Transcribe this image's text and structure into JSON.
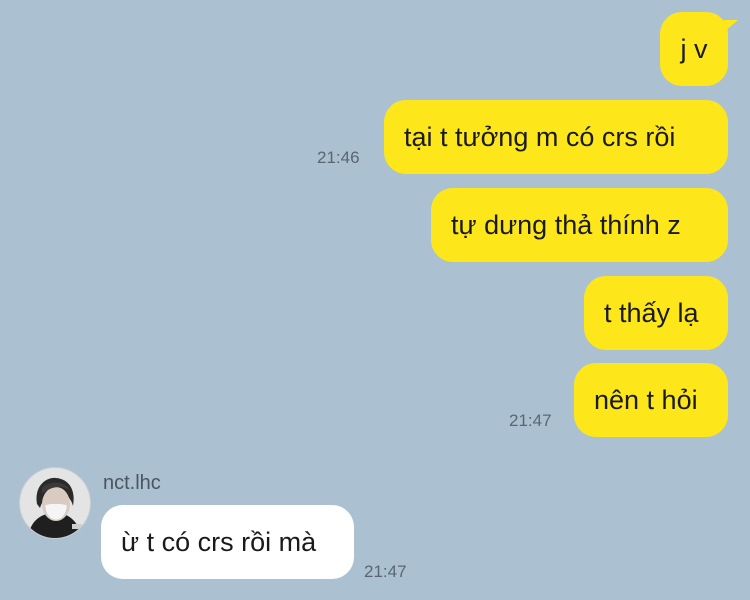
{
  "colors": {
    "background": "#abc1d1",
    "sent_bubble": "#fde71a",
    "received_bubble": "#ffffff"
  },
  "messages": [
    {
      "text": "j v"
    },
    {
      "text": "tại t tưởng m có crs rồi",
      "time": "21:46"
    },
    {
      "text": "tự dưng thả thính z"
    },
    {
      "text": "t thấy lạ"
    },
    {
      "text": "nên t hỏi",
      "time": "21:47"
    }
  ],
  "reply": {
    "sender": "nct.lhc",
    "avatar_icon": "profile-photo-masked-person",
    "text": "ừ t có crs rồi mà",
    "time": "21:47"
  }
}
